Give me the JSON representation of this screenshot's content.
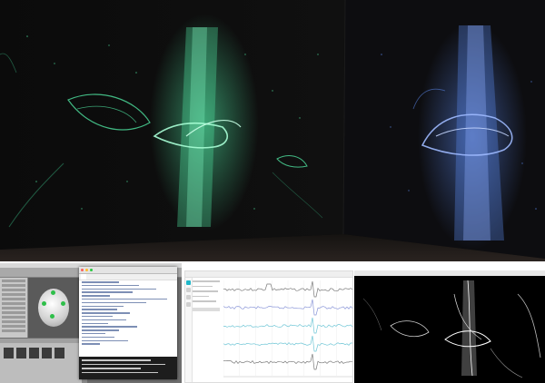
{
  "scene": {
    "colors": {
      "left_wall_particles": "#4fe3a0",
      "right_wall_particles": "#5a86e8",
      "room_background": "#050505"
    }
  },
  "editor": {
    "code_window": {
      "title": "",
      "tab_label": ""
    }
  },
  "eeg_viewer": {
    "title": "",
    "accent_color": "#1fb7c9",
    "channels": [
      {
        "color": "#7a7a7a"
      },
      {
        "color": "#8a96d8"
      },
      {
        "color": "#6fc6d6"
      },
      {
        "color": "#6fc6d6"
      },
      {
        "color": "#7a7a7a"
      }
    ]
  },
  "render_window": {
    "title": ""
  }
}
